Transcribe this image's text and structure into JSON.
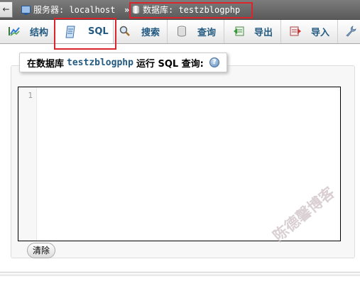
{
  "breadcrumb": {
    "back_symbol": "←",
    "server_label": "服务器: localhost",
    "separator": "»",
    "database_label": "数据库: testzblogphp"
  },
  "tabs": [
    {
      "label": "结构",
      "icon": "structure-icon"
    },
    {
      "label": "SQL",
      "icon": "sql-icon",
      "active": true
    },
    {
      "label": "搜索",
      "icon": "search-icon"
    },
    {
      "label": "查询",
      "icon": "query-icon"
    },
    {
      "label": "导出",
      "icon": "export-icon"
    },
    {
      "label": "导入",
      "icon": "import-icon"
    },
    {
      "label": "",
      "icon": "wrench-icon"
    }
  ],
  "query_panel": {
    "legend_prefix": "在数据库",
    "database_name": "testzblogphp",
    "legend_suffix": "运行 SQL 查询:",
    "help_symbol": "?"
  },
  "editor": {
    "line_number": "1",
    "content": ""
  },
  "buttons": {
    "clear_label": "清除"
  },
  "watermark": {
    "text": "陈德馨博客"
  },
  "colors": {
    "highlight_box": "#d9262c",
    "tab_label": "#235a81",
    "breadcrumb_bg": "#6a6a6a"
  }
}
